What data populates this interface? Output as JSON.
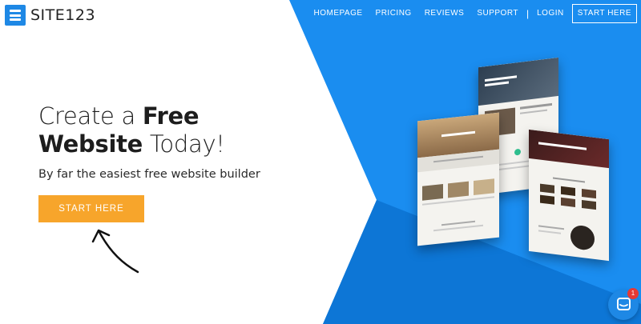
{
  "header": {
    "logo_text": "SITE123",
    "nav": [
      {
        "label": "HOMEPAGE"
      },
      {
        "label": "PRICING"
      },
      {
        "label": "REVIEWS"
      },
      {
        "label": "SUPPORT"
      },
      {
        "label": "LOGIN"
      }
    ],
    "separator": "|",
    "cta_label": "START HERE"
  },
  "hero": {
    "headline_part1": "Create a ",
    "headline_bold1": "Free",
    "headline_bold2": "Website",
    "headline_part2": " Today!",
    "subheadline": "By far the easiest free website builder",
    "cta_label": "START HERE"
  },
  "chat": {
    "badge_count": "1"
  },
  "colors": {
    "brand_blue": "#1e88e5",
    "accent_orange": "#f7a52b",
    "badge_red": "#e53935"
  },
  "icons": [
    "logo-icon",
    "arrow-icon",
    "chat-icon"
  ]
}
